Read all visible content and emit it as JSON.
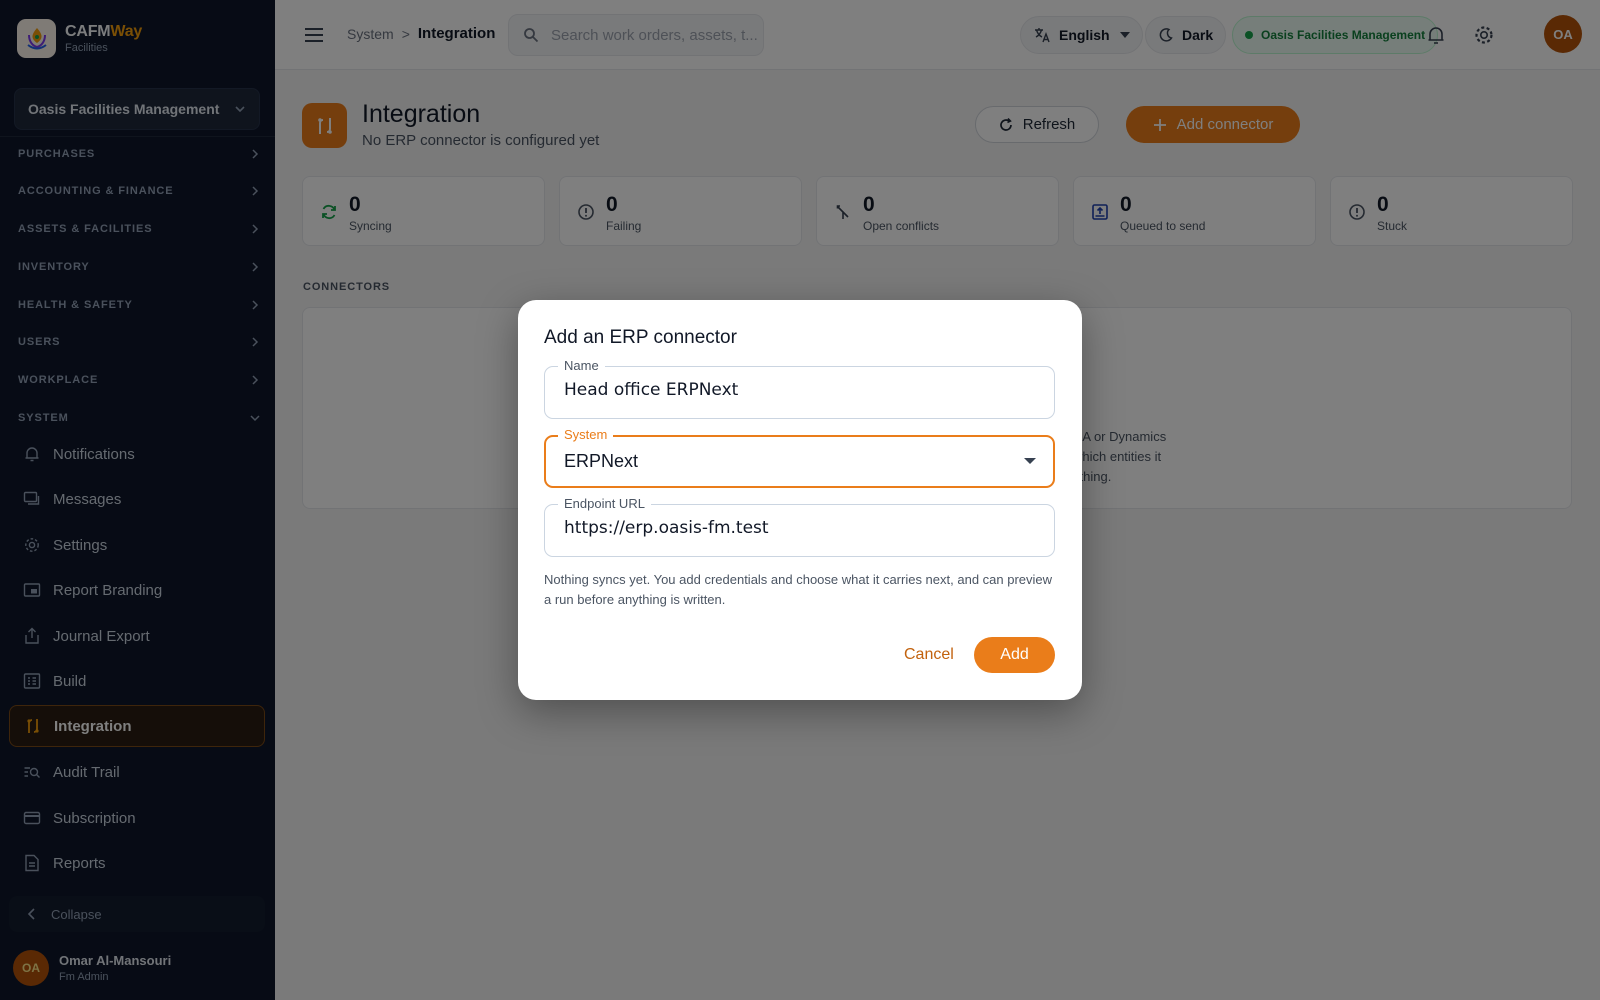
{
  "brand": {
    "name_main": "CAFM",
    "name_accent": "Way",
    "subtitle": "Facilities"
  },
  "sidebar": {
    "org_selector": "Oasis Facilities Management",
    "sections": [
      {
        "label": "PURCHASES",
        "expanded": false
      },
      {
        "label": "ACCOUNTING & FINANCE",
        "expanded": false
      },
      {
        "label": "ASSETS & FACILITIES",
        "expanded": false
      },
      {
        "label": "INVENTORY",
        "expanded": false
      },
      {
        "label": "HEALTH & SAFETY",
        "expanded": false
      },
      {
        "label": "USERS",
        "expanded": false
      },
      {
        "label": "WORKPLACE",
        "expanded": false
      },
      {
        "label": "SYSTEM",
        "expanded": true
      }
    ],
    "system_items": [
      {
        "label": "Notifications",
        "icon": "bell-icon"
      },
      {
        "label": "Messages",
        "icon": "messages-icon"
      },
      {
        "label": "Settings",
        "icon": "gear-icon"
      },
      {
        "label": "Report Branding",
        "icon": "branding-icon"
      },
      {
        "label": "Journal Export",
        "icon": "export-icon"
      },
      {
        "label": "Build",
        "icon": "build-icon"
      },
      {
        "label": "Integration",
        "icon": "integration-icon",
        "active": true
      },
      {
        "label": "Audit Trail",
        "icon": "audit-icon"
      },
      {
        "label": "Subscription",
        "icon": "card-icon"
      },
      {
        "label": "Reports",
        "icon": "reports-icon"
      }
    ],
    "collapse_label": "Collapse",
    "user": {
      "initials": "OA",
      "name": "Omar Al-Mansouri",
      "role": "Fm Admin"
    }
  },
  "topbar": {
    "breadcrumb": {
      "parent": "System",
      "separator": ">",
      "current": "Integration"
    },
    "search_placeholder": "Search work orders, assets, t...",
    "language": "English",
    "theme_label": "Dark",
    "org_badge": "Oasis Facilities Management",
    "avatar_initials": "OA"
  },
  "page": {
    "title": "Integration",
    "subtitle": "No ERP connector is configured yet",
    "refresh_label": "Refresh",
    "add_connector_label": "Add connector",
    "stats": [
      {
        "value": "0",
        "label": "Syncing",
        "icon": "sync-icon"
      },
      {
        "value": "0",
        "label": "Failing",
        "icon": "alert-circle-icon"
      },
      {
        "value": "0",
        "label": "Open conflicts",
        "icon": "merge-icon"
      },
      {
        "value": "0",
        "label": "Queued to send",
        "icon": "outbox-icon"
      },
      {
        "value": "0",
        "label": "Stuck",
        "icon": "alert-circle-icon"
      }
    ],
    "connectors_section_label": "CONNECTORS",
    "connectors_empty_fragment": [
      "NA or Dynamics",
      "which entities it",
      "ything."
    ]
  },
  "dialog": {
    "title": "Add an ERP connector",
    "name_label": "Name",
    "name_value": "Head office ERPNext",
    "system_label": "System",
    "system_value": "ERPNext",
    "endpoint_label": "Endpoint URL",
    "endpoint_value": "https://erp.oasis-fm.test",
    "hint": "Nothing syncs yet. You add credentials and choose what it carries next, and can preview a run before anything is written.",
    "cancel_label": "Cancel",
    "add_label": "Add"
  },
  "colors": {
    "accent": "#ea7d1a",
    "sidebar_bg": "#0f172a",
    "success": "#16a34a"
  }
}
